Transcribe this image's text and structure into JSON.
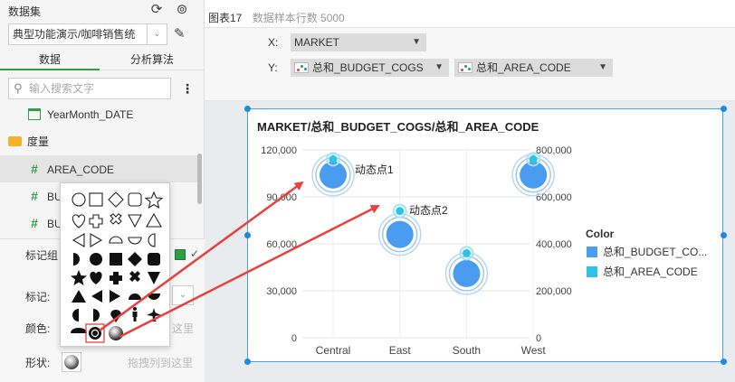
{
  "left": {
    "dataset_title": "数据集",
    "dataset_value": "典型功能演示/咖啡销售统",
    "tabs": [
      "数据",
      "分析算法"
    ],
    "search_placeholder": "输入搜索文字",
    "fields": {
      "yearmonth": "YearMonth_DATE",
      "measures": "度量",
      "area_code": "AREA_CODE",
      "bu1": "BU",
      "bu2": "BU"
    },
    "mark_group": "标记组",
    "mark": "标记:",
    "color": "颜色:",
    "shape": "形状:",
    "drop_here": "这里",
    "drop_here_shape": "拖拽列到这里"
  },
  "right": {
    "chart_name": "图表17",
    "sample_rows": "数据样本行数 5000",
    "x_label": "X:",
    "y_label": "Y:",
    "x_field": "MARKET",
    "y_fields": [
      "总和_BUDGET_COGS",
      "总和_AREA_CODE"
    ]
  },
  "colors": {
    "series1": "#4a9cf0",
    "series2": "#2ec4e8",
    "accent": "#2ea043",
    "arrow": "#e8403a"
  },
  "chart_data": {
    "type": "scatter",
    "title": "MARKET/总和_BUDGET_COGS/总和_AREA_CODE",
    "categories": [
      "Central",
      "East",
      "South",
      "West"
    ],
    "left_ticks": [
      "120,000",
      "90,000",
      "60,000",
      "30,000",
      "0"
    ],
    "right_ticks": [
      "800,000",
      "600,000",
      "400,000",
      "200,000",
      "0"
    ],
    "left_range": [
      0,
      120000
    ],
    "right_range": [
      0,
      800000
    ],
    "series": [
      {
        "name": "总和_BUDGET_COGS",
        "axis": "left",
        "values": [
          104000,
          66000,
          41000,
          104000
        ]
      },
      {
        "name": "总和_AREA_CODE",
        "axis": "right",
        "values": [
          760000,
          540000,
          360000,
          760000
        ]
      }
    ],
    "annotations": [
      "动态点1",
      "动态点2"
    ],
    "legend_title": "Color",
    "legend": [
      "总和_BUDGET_CO...",
      "总和_AREA_CODE"
    ]
  }
}
